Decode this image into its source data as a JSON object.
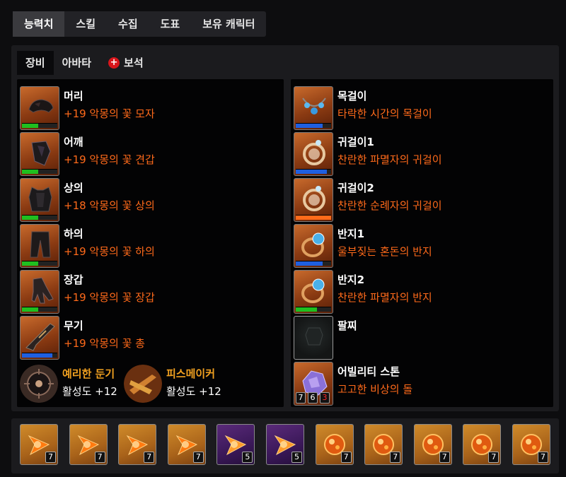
{
  "top_tabs": [
    "능력치",
    "스킬",
    "수집",
    "도표",
    "보유 캐릭터"
  ],
  "sub_tabs": [
    "장비",
    "아바타",
    "보석"
  ],
  "gem_badge": "+",
  "equipment_left": [
    {
      "slot": "머리",
      "item": "+19 악몽의 꽃 모자",
      "icon": "helmet-icon",
      "bar_color": "#1fbf1f",
      "bar_fraction": 0.45
    },
    {
      "slot": "어깨",
      "item": "+19 악몽의 꽃 견갑",
      "icon": "shoulder-icon",
      "bar_color": "#1fbf1f",
      "bar_fraction": 0.45
    },
    {
      "slot": "상의",
      "item": "+18 악몽의 꽃 상의",
      "icon": "chest-armor-icon",
      "bar_color": "#1fbf1f",
      "bar_fraction": 0.45
    },
    {
      "slot": "하의",
      "item": "+19 악몽의 꽃 하의",
      "icon": "pants-icon",
      "bar_color": "#1fbf1f",
      "bar_fraction": 0.45
    },
    {
      "slot": "장갑",
      "item": "+19 악몽의 꽃 장갑",
      "icon": "gloves-icon",
      "bar_color": "#1fbf1f",
      "bar_fraction": 0.45
    },
    {
      "slot": "무기",
      "item": "+19 악몽의 꽃 총",
      "icon": "gun-icon",
      "bar_color": "#1f5fe0",
      "bar_fraction": 0.85
    }
  ],
  "skills": [
    {
      "name": "예리한 둔기",
      "stat": "활성도 +12",
      "icon": "keen-blunt-engraving-icon"
    },
    {
      "name": "피스메이커",
      "stat": "활성도 +12",
      "icon": "peacemaker-engraving-icon"
    }
  ],
  "equipment_right": [
    {
      "slot": "목걸이",
      "item": "타락한 시간의 목걸이",
      "icon": "necklace-icon",
      "bar_color": "#1f5fe0",
      "bar_fraction": 0.75
    },
    {
      "slot": "귀걸이1",
      "item": "찬란한 파멸자의 귀걸이",
      "icon": "earring-icon",
      "bar_color": "#1f5fe0",
      "bar_fraction": 0.88
    },
    {
      "slot": "귀걸이2",
      "item": "찬란한 순례자의 귀걸이",
      "icon": "earring-icon",
      "bar_color": "#ff6a1a",
      "bar_fraction": 1.0
    },
    {
      "slot": "반지1",
      "item": "울부짖는 혼돈의 반지",
      "icon": "ring-icon",
      "bar_color": "#1f5fe0",
      "bar_fraction": 0.75
    },
    {
      "slot": "반지2",
      "item": "찬란한 파멸자의 반지",
      "icon": "ring-icon",
      "bar_color": "#1fbf1f",
      "bar_fraction": 0.6
    },
    {
      "slot": "팔찌",
      "item": "",
      "icon": "empty-bracelet-slot-icon",
      "bar_color": "",
      "bar_fraction": 0
    }
  ],
  "ability_stone": {
    "slot": "어빌리티 스톤",
    "item": "고고한 비상의 돌",
    "icon": "ability-stone-icon",
    "levels": [
      "7",
      "6",
      "3"
    ],
    "level_colors": [
      "#ffffff",
      "#ffffff",
      "#ff2a2a"
    ]
  },
  "gems": [
    {
      "level": "7",
      "type": "orange",
      "icon": "annihilation-gem-icon"
    },
    {
      "level": "7",
      "type": "orange",
      "icon": "annihilation-gem-icon"
    },
    {
      "level": "7",
      "type": "orange",
      "icon": "annihilation-gem-icon"
    },
    {
      "level": "7",
      "type": "orange",
      "icon": "annihilation-gem-icon"
    },
    {
      "level": "5",
      "type": "purple",
      "icon": "annihilation-gem-icon"
    },
    {
      "level": "5",
      "type": "purple",
      "icon": "annihilation-gem-icon"
    },
    {
      "level": "7",
      "type": "orange",
      "icon": "crimson-flame-gem-icon"
    },
    {
      "level": "7",
      "type": "orange",
      "icon": "crimson-flame-gem-icon"
    },
    {
      "level": "7",
      "type": "orange",
      "icon": "crimson-flame-gem-icon"
    },
    {
      "level": "7",
      "type": "orange",
      "icon": "crimson-flame-gem-icon"
    },
    {
      "level": "7",
      "type": "orange",
      "icon": "crimson-flame-gem-icon"
    }
  ]
}
